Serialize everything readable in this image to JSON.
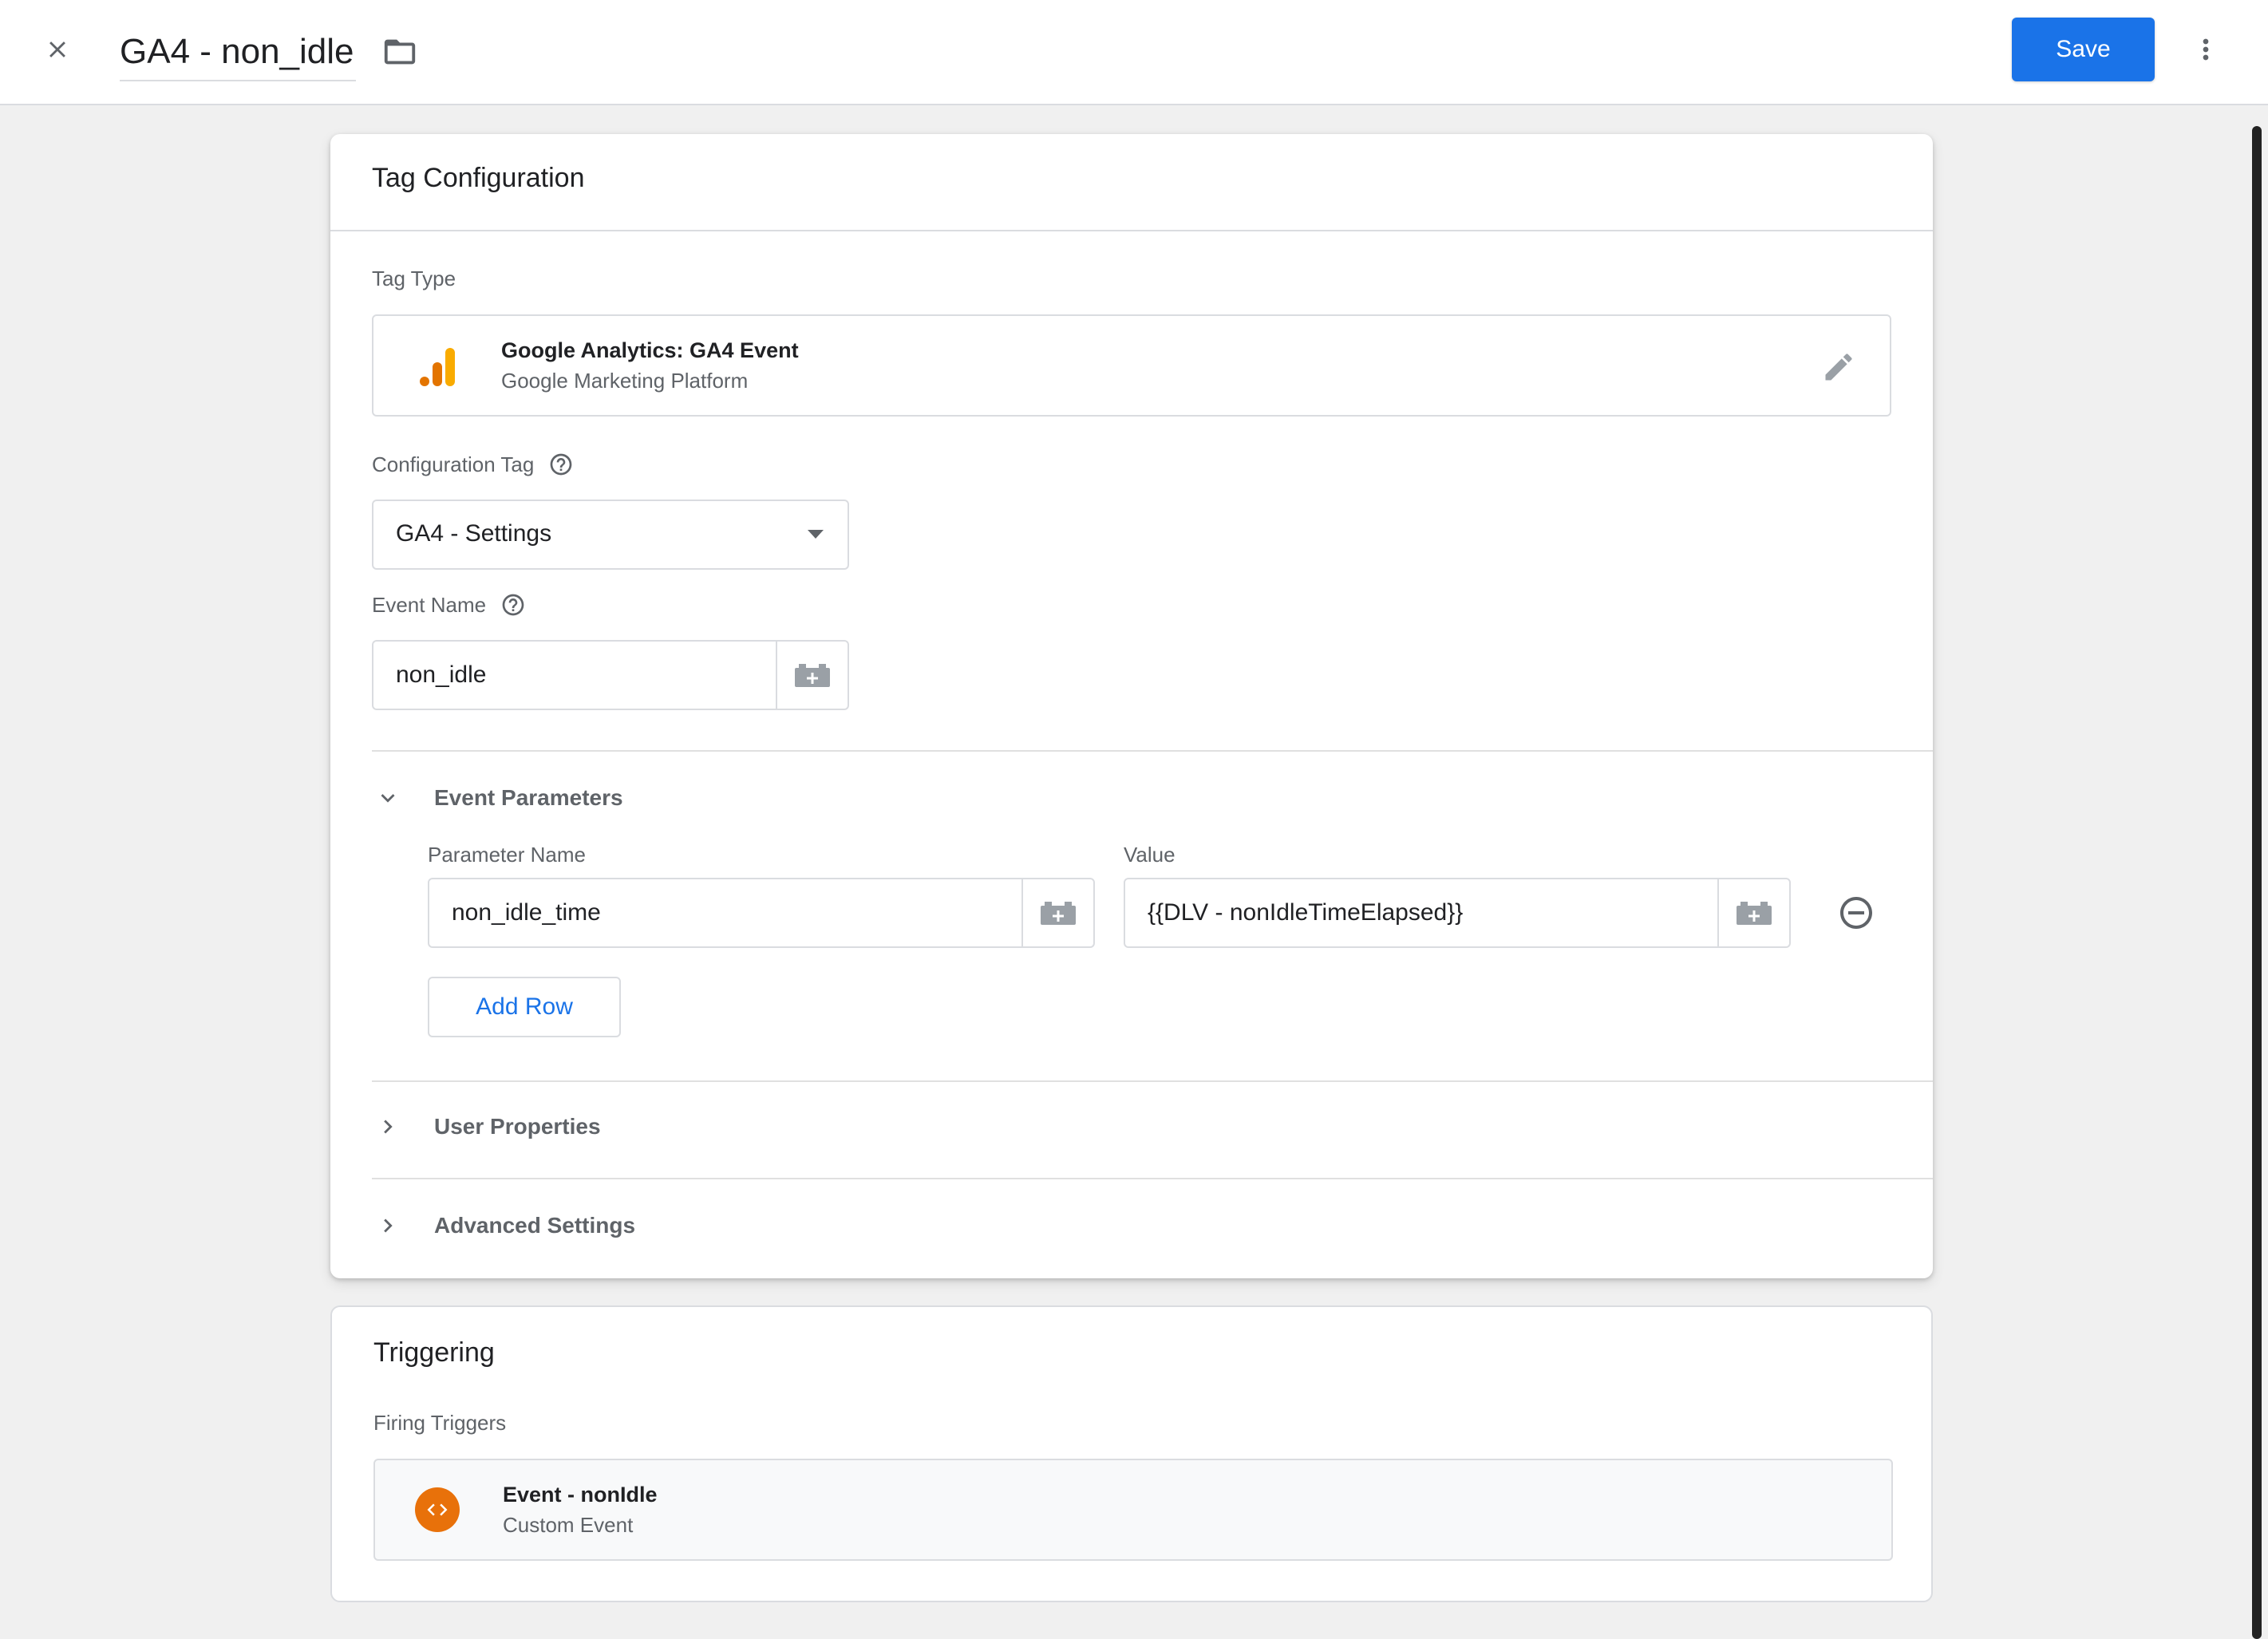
{
  "header": {
    "title": "GA4 - non_idle",
    "save_label": "Save",
    "icons": {
      "close": "close-icon",
      "folder": "folder-icon",
      "more": "more-vert-icon"
    }
  },
  "tag_configuration": {
    "title": "Tag Configuration",
    "tag_type": {
      "label": "Tag Type",
      "name": "Google Analytics: GA4 Event",
      "subtitle": "Google Marketing Platform",
      "icon": "ga4-analytics-icon"
    },
    "configuration_tag": {
      "label": "Configuration Tag",
      "value": "GA4 - Settings"
    },
    "event_name": {
      "label": "Event Name",
      "value": "non_idle"
    },
    "event_parameters": {
      "title": "Event Parameters",
      "expanded": true,
      "param_name_label": "Parameter Name",
      "value_label": "Value",
      "rows": [
        {
          "name": "non_idle_time",
          "value": "{{DLV - nonIdleTimeElapsed}}"
        }
      ],
      "add_row_label": "Add Row"
    },
    "user_properties": {
      "title": "User Properties",
      "expanded": false
    },
    "advanced_settings": {
      "title": "Advanced Settings",
      "expanded": false
    }
  },
  "triggering": {
    "title": "Triggering",
    "firing_label": "Firing Triggers",
    "trigger": {
      "name": "Event - nonIdle",
      "type": "Custom Event",
      "icon": "custom-event-icon",
      "icon_color": "#e8710a"
    }
  },
  "colors": {
    "accent": "#1a73e8",
    "ga4_orange": "#f9ab00",
    "ga4_dark_orange": "#e37400"
  }
}
